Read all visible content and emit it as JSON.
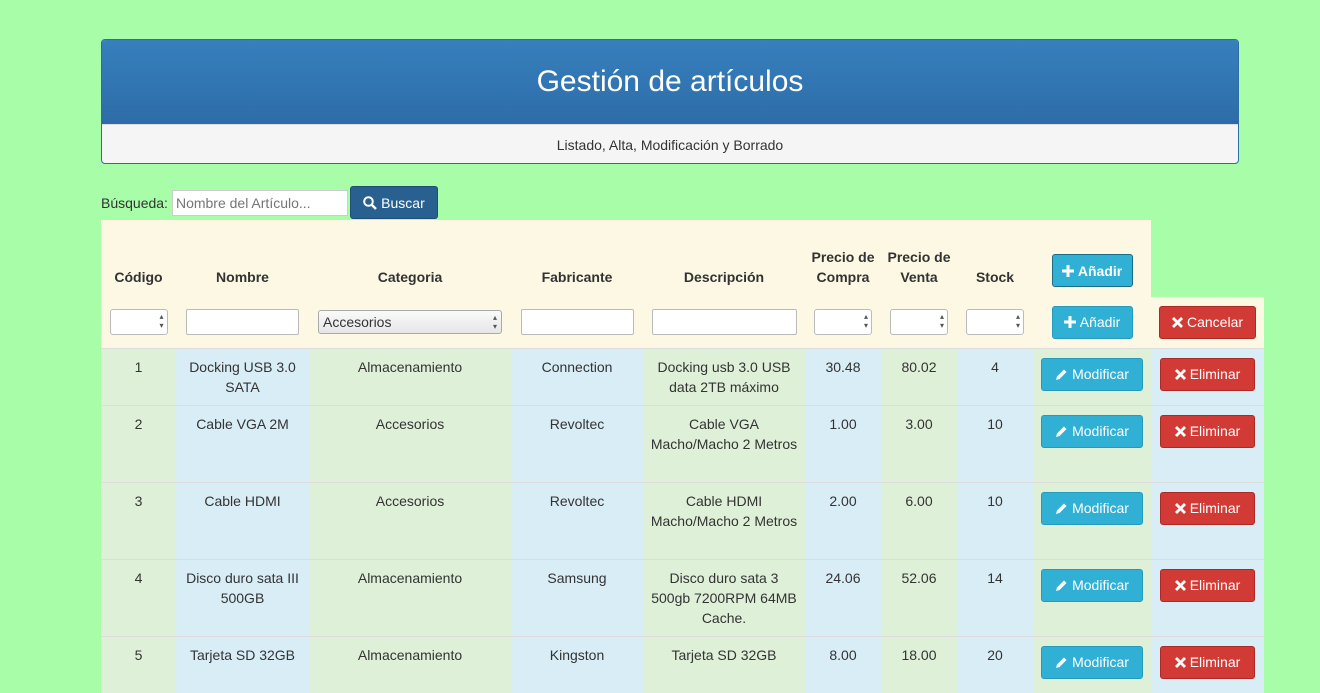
{
  "header": {
    "title": "Gestión de artículos",
    "subtitle": "Listado, Alta, Modificación y Borrado"
  },
  "search": {
    "label": "Búsqueda:",
    "placeholder": "Nombre del Artículo...",
    "button_label": "Buscar"
  },
  "table": {
    "columns": [
      "Código",
      "Nombre",
      "Categoria",
      "Fabricante",
      "Descripción",
      "Precio de Compra",
      "Precio de Venta",
      "Stock"
    ],
    "add_label": "Añadir",
    "filter": {
      "category_value": "Accesorios",
      "add_label": "Añadir",
      "cancel_label": "Cancelar"
    },
    "modify_label": "Modificar",
    "delete_label": "Eliminar",
    "rows": [
      {
        "codigo": "1",
        "nombre": "Docking USB 3.0 SATA",
        "categoria": "Almacenamiento",
        "fabricante": "Connection",
        "descripcion": "Docking usb 3.0 USB data 2TB máximo",
        "compra": "30.48",
        "venta": "80.02",
        "stock": "4"
      },
      {
        "codigo": "2",
        "nombre": "Cable VGA 2M",
        "categoria": "Accesorios",
        "fabricante": "Revoltec",
        "descripcion": "Cable VGA Macho/Macho 2 Metros",
        "compra": "1.00",
        "venta": "3.00",
        "stock": "10"
      },
      {
        "codigo": "3",
        "nombre": "Cable HDMI",
        "categoria": "Accesorios",
        "fabricante": "Revoltec",
        "descripcion": "Cable HDMI Macho/Macho 2 Metros",
        "compra": "2.00",
        "venta": "6.00",
        "stock": "10"
      },
      {
        "codigo": "4",
        "nombre": "Disco duro sata III 500GB",
        "categoria": "Almacenamiento",
        "fabricante": "Samsung",
        "descripcion": "Disco duro sata 3 500gb 7200RPM 64MB Cache.",
        "compra": "24.06",
        "venta": "52.06",
        "stock": "14"
      },
      {
        "codigo": "5",
        "nombre": "Tarjeta SD 32GB",
        "categoria": "Almacenamiento",
        "fabricante": "Kingston",
        "descripcion": "Tarjeta SD 32GB",
        "compra": "8.00",
        "venta": "18.00",
        "stock": "20"
      }
    ]
  },
  "colors": {
    "background": "#a8fea8",
    "primary": "#337ab7",
    "info": "#31b0d5",
    "danger": "#d23a35"
  }
}
